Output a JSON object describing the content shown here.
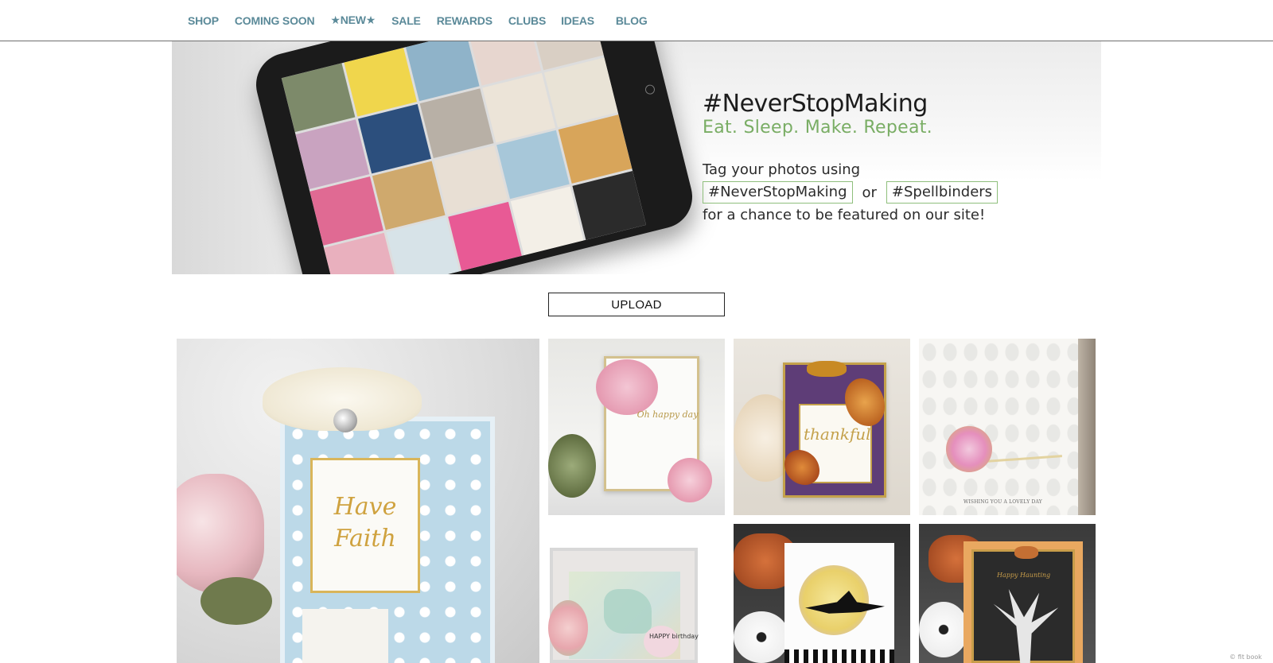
{
  "nav": {
    "items": [
      {
        "label": "SHOP"
      },
      {
        "label": "COMING SOON"
      },
      {
        "label": "★NEW★"
      },
      {
        "label": "SALE"
      },
      {
        "label": "REWARDS"
      },
      {
        "label": "CLUBS"
      },
      {
        "label": "IDEAS"
      },
      {
        "label": "BLOG"
      }
    ],
    "color": "#5b8a99"
  },
  "hero": {
    "title": "#NeverStopMaking",
    "subtitle": "Eat. Sleep. Make. Repeat.",
    "tag_intro": "Tag your photos using",
    "tag_1": "#NeverStopMaking",
    "tag_or": "or",
    "tag_2": "#Spellbinders",
    "chance": "for a chance to be featured on our site!",
    "subtitle_color": "#79ad64",
    "tag_border_color": "#8fbf7c"
  },
  "upload": {
    "label": "UPLOAD"
  },
  "gallery": {
    "cards": [
      {
        "script": "Have Faith"
      },
      {
        "script": "Oh happy day"
      },
      {
        "caption": "thankful"
      },
      {
        "caption": "WISHING YOU A LOVELY DAY"
      },
      {
        "caption": "HAPPY birthday"
      },
      {
        "caption": ""
      },
      {
        "caption": "Happy Haunting"
      }
    ]
  },
  "watermark": {
    "text": "© fit book"
  }
}
